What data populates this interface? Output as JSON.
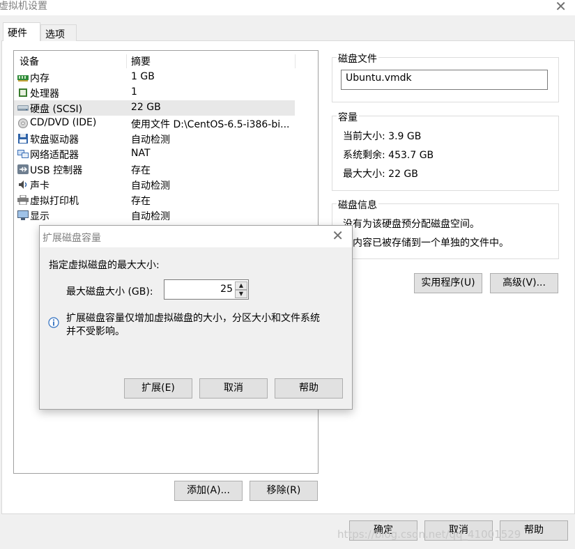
{
  "window": {
    "title": "虚拟机设置",
    "close_glyph": "✕"
  },
  "tabs": [
    {
      "label": "硬件",
      "active": true
    },
    {
      "label": "选项",
      "active": false
    }
  ],
  "device_list": {
    "columns": [
      "设备",
      "摘要"
    ],
    "rows": [
      {
        "name": "内存",
        "summary": "1 GB",
        "icon": "memory-icon"
      },
      {
        "name": "处理器",
        "summary": "1",
        "icon": "processor-icon"
      },
      {
        "name": "硬盘 (SCSI)",
        "summary": "22 GB",
        "icon": "hard-disk-icon",
        "selected": true
      },
      {
        "name": "CD/DVD (IDE)",
        "summary": "使用文件 D:\\CentOS-6.5-i386-bi...",
        "icon": "cd-dvd-icon"
      },
      {
        "name": "软盘驱动器",
        "summary": "自动检测",
        "icon": "floppy-icon"
      },
      {
        "name": "网络适配器",
        "summary": "NAT",
        "icon": "network-adapter-icon"
      },
      {
        "name": "USB 控制器",
        "summary": "存在",
        "icon": "usb-icon"
      },
      {
        "name": "声卡",
        "summary": "自动检测",
        "icon": "sound-card-icon"
      },
      {
        "name": "虚拟打印机",
        "summary": "存在",
        "icon": "printer-icon"
      },
      {
        "name": "显示",
        "summary": "自动检测",
        "icon": "display-icon"
      }
    ],
    "add_button": "添加(A)...",
    "remove_button": "移除(R)"
  },
  "disk_file": {
    "label": "磁盘文件",
    "value": "Ubuntu.vmdk"
  },
  "capacity": {
    "label": "容量",
    "current_size": "当前大小: 3.9 GB",
    "system_free": "系统剩余: 453.7 GB",
    "max_size": "最大大小: 22 GB"
  },
  "disk_info": {
    "label": "磁盘信息",
    "line1": "没有为该硬盘预分配磁盘空间。",
    "line2": "盘内容已被存储到一个单独的文件中。"
  },
  "utility_button": "实用程序(U)",
  "advanced_button": "高级(V)...",
  "footer": {
    "ok": "确定",
    "cancel": "取消",
    "help": "帮助"
  },
  "expand_dialog": {
    "title": "扩展磁盘容量",
    "prompt": "指定虚拟磁盘的最大大小:",
    "field_label": "最大磁盘大小 (GB):",
    "field_value": "25",
    "info_line1": "扩展磁盘容量仅增加虚拟磁盘的大小，分区大小和文件系统",
    "info_line2": "并不受影响。",
    "expand_button": "扩展(E)",
    "cancel_button": "取消",
    "help_button": "帮助"
  },
  "watermark": "https://blog.csdn.net/qq_41001529",
  "colors": {
    "selected_row": "#e8e8e8",
    "button_face": "#e1e1e1",
    "window_bg": "#f0f0f0"
  }
}
